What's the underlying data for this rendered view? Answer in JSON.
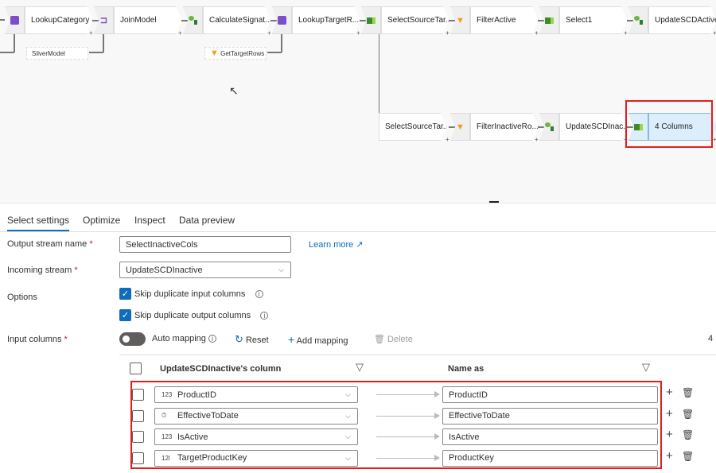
{
  "canvas": {
    "top_row": [
      {
        "label": "LookupCategory",
        "icon": "lookup-icon"
      },
      {
        "label": "JoinModel",
        "icon": "join-icon"
      },
      {
        "label": "CalculateSignat...",
        "icon": "derived-column-icon"
      },
      {
        "label": "LookupTargetR...",
        "icon": "lookup-icon"
      },
      {
        "label": "SelectSourceTar...",
        "icon": "select-icon"
      },
      {
        "label": "FilterActive",
        "icon": "filter-icon"
      },
      {
        "label": "Select1",
        "icon": "select-icon"
      },
      {
        "label": "UpdateSCDActive",
        "icon": "derived-column-icon"
      }
    ],
    "bottom_row": [
      {
        "label": "SelectSourceTar...",
        "icon": ""
      },
      {
        "label": "FilterInactiveRo...",
        "icon": "filter-icon"
      },
      {
        "label": "UpdateSCDInac...",
        "icon": "derived-column-icon"
      },
      {
        "label": "4 Columns",
        "icon": "select-icon",
        "selected": true
      }
    ],
    "side_streams": [
      "SilverModel",
      "GetTargetRows"
    ]
  },
  "tabs": [
    "Select settings",
    "Optimize",
    "Inspect",
    "Data preview"
  ],
  "active_tab": "Select settings",
  "form": {
    "output_stream_label": "Output stream name",
    "output_stream_value": "SelectInactiveCols",
    "learn_more": "Learn more",
    "incoming_stream_label": "Incoming stream",
    "incoming_stream_value": "UpdateSCDInactive",
    "options_label": "Options",
    "skip_input": "Skip duplicate input columns",
    "skip_input_checked": true,
    "skip_output": "Skip duplicate output columns",
    "skip_output_checked": true,
    "input_columns_label": "Input columns",
    "auto_mapping": "Auto mapping",
    "auto_mapping_on": false,
    "reset": "Reset",
    "add_mapping": "Add mapping",
    "delete": "Delete",
    "count": "4",
    "required": "*"
  },
  "table": {
    "col1": "UpdateSCDInactive's column",
    "col2": "Name as",
    "rows": [
      {
        "type": "123",
        "source": "ProductID",
        "name": "ProductID"
      },
      {
        "type": "⏱",
        "source": "EffectiveToDate",
        "name": "EffectiveToDate"
      },
      {
        "type": "123",
        "source": "IsActive",
        "name": "IsActive"
      },
      {
        "type": "12l",
        "source": "TargetProductKey",
        "name": "ProductKey"
      }
    ]
  },
  "colors": {
    "accent": "#0f6cbd",
    "highlight": "#e0201f",
    "selected_node": "#dcedfb"
  }
}
